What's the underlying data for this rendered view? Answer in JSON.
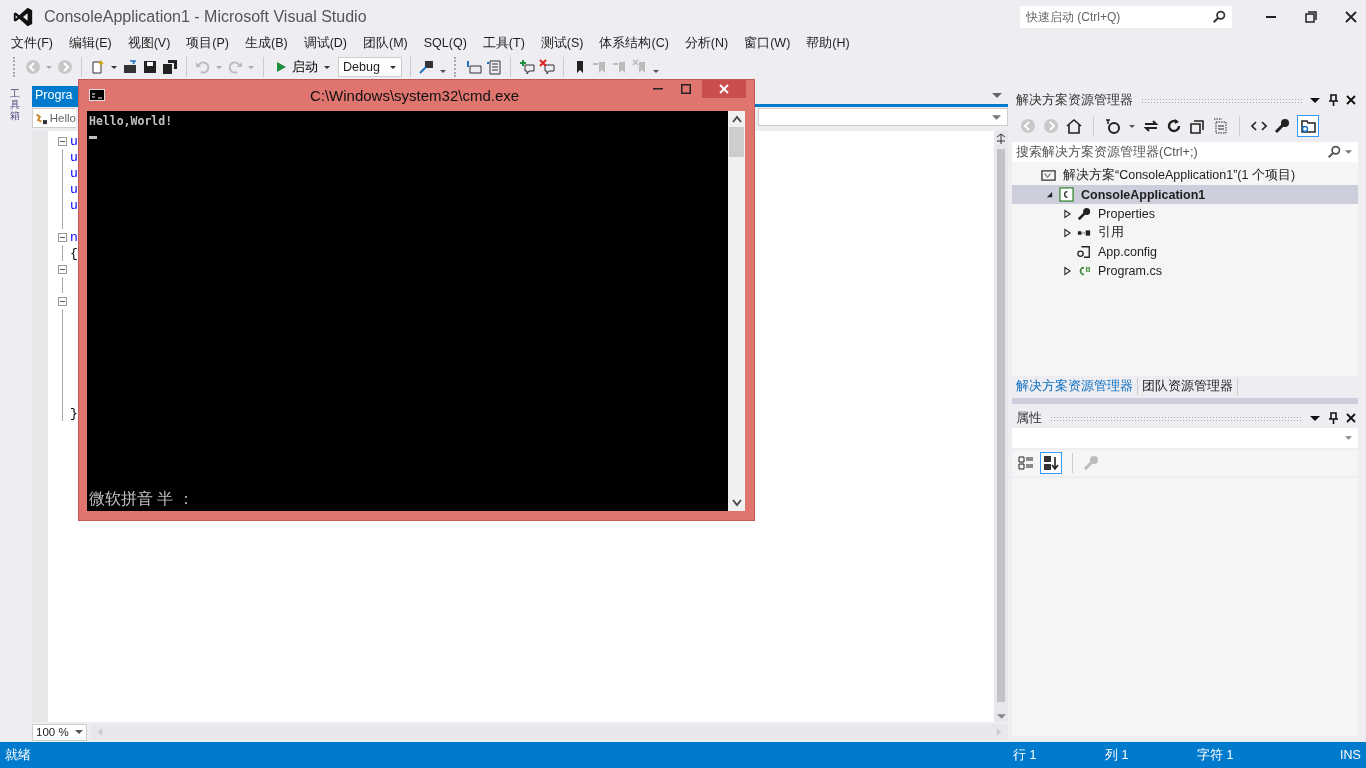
{
  "window": {
    "title": "ConsoleApplication1 - Microsoft Visual Studio"
  },
  "quick_launch": {
    "placeholder": "快速启动 (Ctrl+Q)"
  },
  "menu": [
    "文件(F)",
    "编辑(E)",
    "视图(V)",
    "项目(P)",
    "生成(B)",
    "调试(D)",
    "团队(M)",
    "SQL(Q)",
    "工具(T)",
    "测试(S)",
    "体系结构(C)",
    "分析(N)",
    "窗口(W)",
    "帮助(H)"
  ],
  "toolbar": {
    "start_button": "启动",
    "configuration": "Debug"
  },
  "toolbox_tab": "工具箱",
  "editor": {
    "tab": "Progra",
    "nav": "Hello",
    "zoom": "100 %",
    "lines": [
      {
        "kind": "keyword",
        "text": "u",
        "fold": true
      },
      {
        "kind": "keyword",
        "text": "u",
        "fold": false
      },
      {
        "kind": "keyword",
        "text": "u",
        "fold": false
      },
      {
        "kind": "keyword",
        "text": "u",
        "fold": false
      },
      {
        "kind": "keyword",
        "text": "u",
        "fold": false
      },
      {
        "kind": "blank",
        "fold": false
      },
      {
        "kind": "keyword",
        "text": "n",
        "fold": true
      },
      {
        "kind": "punct",
        "text": "{",
        "fold": false
      },
      {
        "kind": "blank",
        "fold": true
      },
      {
        "kind": "blank",
        "fold": false
      },
      {
        "kind": "blank",
        "fold": true
      },
      {
        "kind": "blank",
        "fold": false
      },
      {
        "kind": "blank",
        "fold": false
      },
      {
        "kind": "blank",
        "fold": false
      },
      {
        "kind": "blank",
        "fold": false
      },
      {
        "kind": "blank",
        "fold": false
      },
      {
        "kind": "blank",
        "fold": false
      },
      {
        "kind": "punct",
        "text": "}",
        "fold": false
      }
    ]
  },
  "console": {
    "title": "C:\\Windows\\system32\\cmd.exe",
    "output": "Hello,World!",
    "ime": "微软拼音 半 ："
  },
  "solution_explorer": {
    "title": "解决方案资源管理器",
    "search": {
      "placeholder": "搜索解决方案资源管理器(Ctrl+;)"
    },
    "tree": [
      {
        "label": "解决方案“ConsoleApplication1”(1 个项目)",
        "kind": "solution",
        "selected": false,
        "children": [
          {
            "label": "ConsoleApplication1",
            "kind": "project",
            "expanded": true,
            "selected": true,
            "children": [
              {
                "label": "Properties",
                "kind": "properties",
                "expanded": false,
                "selected": false
              },
              {
                "label": "引用",
                "kind": "references",
                "expanded": false,
                "selected": false
              },
              {
                "label": "App.config",
                "kind": "config",
                "selected": false
              },
              {
                "label": "Program.cs",
                "kind": "csharp",
                "expanded": false,
                "selected": false
              }
            ]
          }
        ]
      }
    ]
  },
  "panel_tabs": [
    {
      "label": "解决方案资源管理器",
      "selected": true
    },
    {
      "label": "团队资源管理器",
      "selected": false
    }
  ],
  "properties": {
    "title": "属性"
  },
  "status_bar": {
    "state": "就绪",
    "line": "行 1",
    "column": "列 1",
    "char": "字符 1",
    "mode": "INS"
  }
}
